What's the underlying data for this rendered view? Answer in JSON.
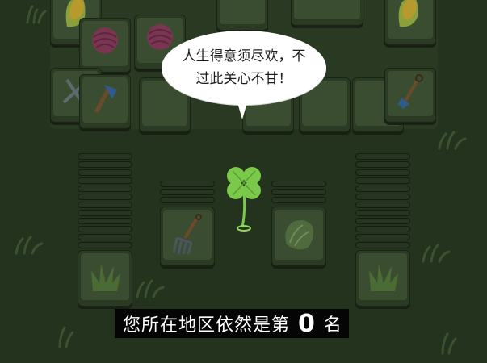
{
  "speech_bubble": {
    "text": "人生得意须尽欢，不\n过此关心不甘！"
  },
  "caption": {
    "prefix": "您所在地区依然是第",
    "rank": "0",
    "suffix": "名"
  },
  "tiles": {
    "board_top_row": [
      "corn-icon",
      "yarn-icon",
      "yarn-icon",
      "cabbage-icon",
      "corn-icon"
    ],
    "board_second_row": [
      "scissors-icon",
      "axe-icon",
      "boot-icon",
      "shovel-icon"
    ],
    "stack_left": "grass-icon",
    "stack_middle_left": "rake-icon",
    "stack_middle_right": "cabbage-icon",
    "stack_right": "grass-icon"
  },
  "colors": {
    "background": "#24331d",
    "clover": "#7bc94a",
    "bubble": "#ffffff",
    "caption_bg": "#050505"
  }
}
